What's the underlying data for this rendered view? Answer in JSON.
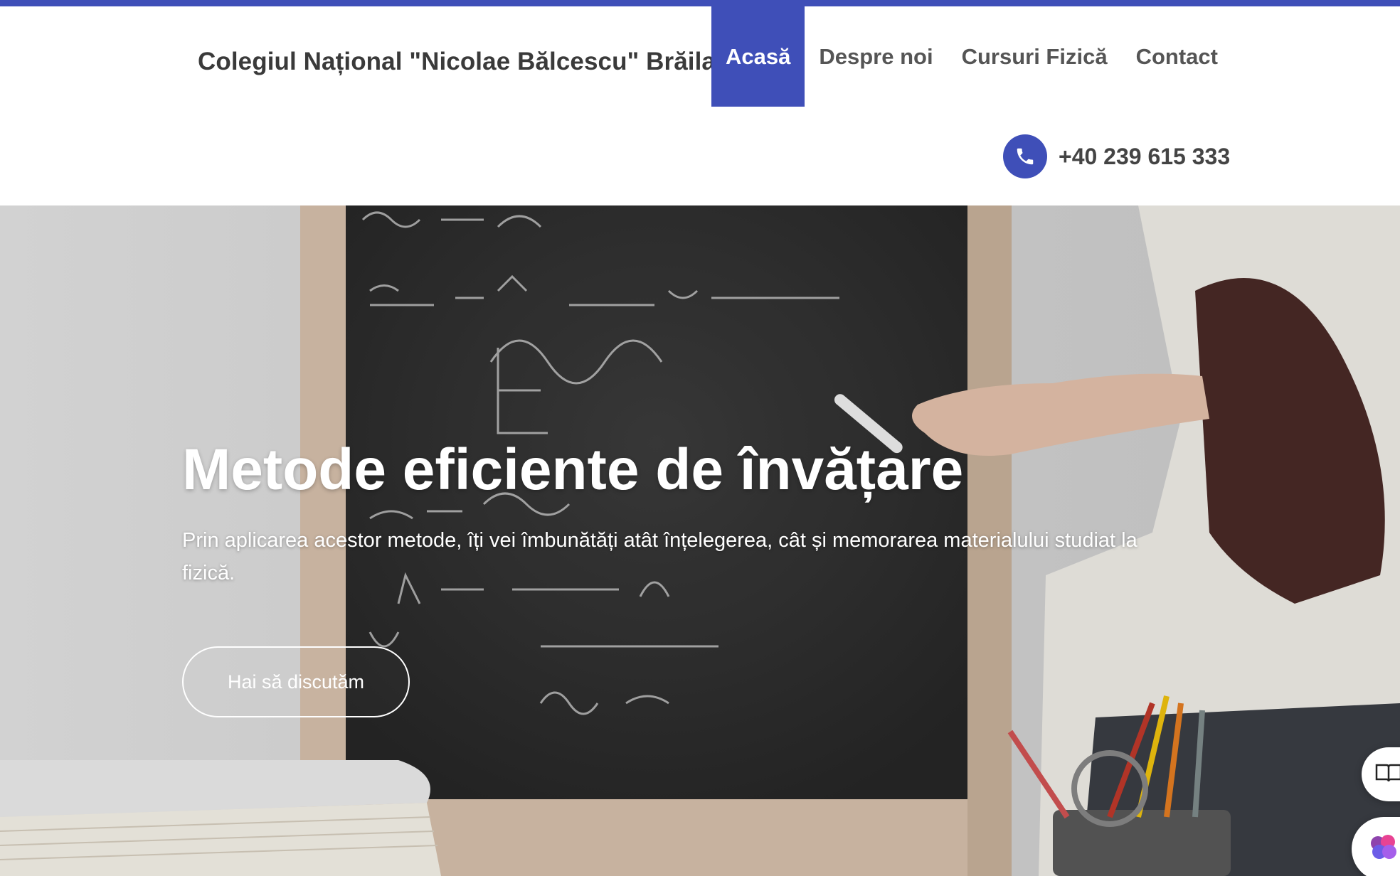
{
  "header": {
    "site_title": "Colegiul Național \"Nicolae Bălcescu\" Brăila",
    "nav": [
      {
        "label": "Acasă",
        "active": true
      },
      {
        "label": "Despre noi",
        "active": false
      },
      {
        "label": "Cursuri Fizică",
        "active": false
      },
      {
        "label": "Contact",
        "active": false
      }
    ],
    "phone": {
      "icon": "phone-icon",
      "number": "+40 239 615 333"
    }
  },
  "hero": {
    "title": "Metode eficiente de învățare",
    "subtitle": "Prin aplicarea acestor metode, îți vei îmbunătăți atât înțelegerea, cât și memorarea materialului studiat la fizică.",
    "cta_label": "Hai să discutăm"
  },
  "floating": {
    "reader_icon": "open-book-icon",
    "assistant_icon": "brain-icon"
  },
  "colors": {
    "accent": "#3f4fb8",
    "nav_text": "#555555",
    "title_text": "#3a3a3a"
  }
}
